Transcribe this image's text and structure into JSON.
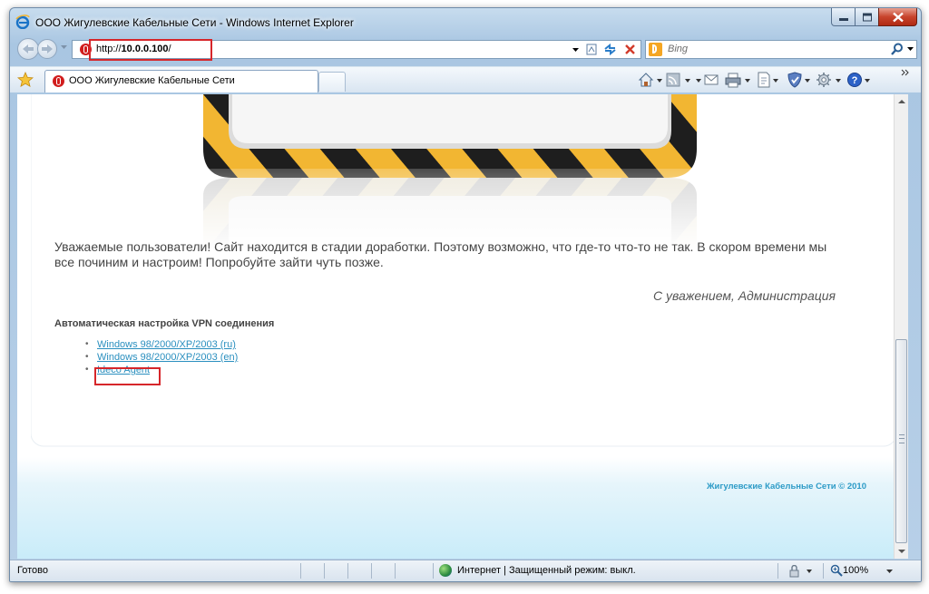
{
  "window": {
    "title": "ООО Жигулевские Кабельные Сети - Windows Internet Explorer"
  },
  "navigation": {
    "address_prefix": "http://",
    "address_host": "10.0.0.100",
    "address_suffix": "/",
    "search_placeholder": "Bing"
  },
  "tabs": [
    {
      "label": "ООО Жигулевские Кабельные Сети"
    }
  ],
  "page": {
    "notice": "Уважаемые  пользователи! Сайт находится в стадии доработки. Поэтому возможно, что где-то что-то не так. В скором времени мы все починим и настроим! Попробуйте зайти чуть позже.",
    "signature": "С уважением, Администрация",
    "vpn_title": "Автоматическая настройка VPN соединения",
    "links": [
      {
        "label": "Windows 98/2000/XP/2003 (ru)"
      },
      {
        "label": "Windows 98/2000/XP/2003 (en)"
      },
      {
        "label": "Ideco Agent"
      }
    ],
    "footer": "Жигулевские Кабельные Сети © 2010"
  },
  "statusbar": {
    "status": "Готово",
    "zone": "Интернет | Защищенный режим: выкл.",
    "zoom": "100%"
  },
  "colors": {
    "highlight": "#d6262a",
    "link": "#2a8fbf",
    "footer": "#2d9bc7",
    "banner_yellow": "#f2b632",
    "banner_black": "#1e1e1e"
  }
}
